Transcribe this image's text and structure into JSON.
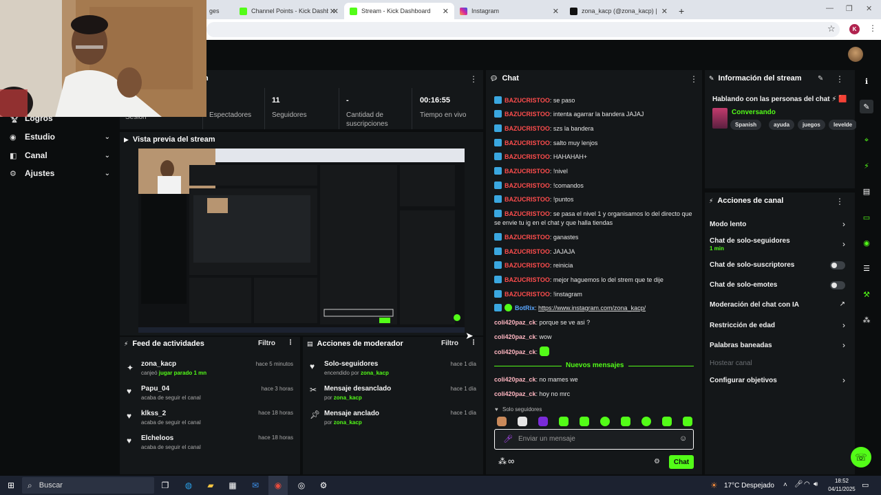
{
  "browser": {
    "tabs": [
      {
        "label": "ges",
        "close": "✕"
      },
      {
        "label": "Channel Points - Kick Dashboar",
        "close": "✕"
      },
      {
        "label": "Stream - Kick Dashboard",
        "close": "✕"
      },
      {
        "label": "Instagram",
        "close": "✕"
      },
      {
        "label": "zona_kacp (@zona_kacp) | TikT",
        "close": "✕"
      }
    ],
    "new_tab": "+",
    "profile_initial": "K"
  },
  "sidebar": {
    "items": [
      {
        "label": "Logros"
      },
      {
        "label": "Estudio"
      },
      {
        "label": "Canal"
      },
      {
        "label": "Ajustes"
      }
    ]
  },
  "stats": {
    "header_fragment": "n",
    "items": [
      {
        "value": "",
        "label": "Sesión"
      },
      {
        "value": "",
        "label": "Espectadores"
      },
      {
        "value": "11",
        "label": "Seguidores"
      },
      {
        "value": "-",
        "label": "Cantidad de suscripciones"
      },
      {
        "value": "00:16:55",
        "label": "Tiempo en vivo"
      }
    ]
  },
  "preview": {
    "title": "Vista previa del stream"
  },
  "feed": {
    "title": "Feed de actividades",
    "filter": "Filtro",
    "entries": [
      {
        "name": "zona_kacp",
        "pre": "canjeó ",
        "highlight": "jugar parado 1 mn",
        "post": "",
        "time": "hace 5 minutos"
      },
      {
        "name": "Papu_04",
        "pre": "acaba de seguir el canal",
        "highlight": "",
        "post": "",
        "time": "hace 3 horas"
      },
      {
        "name": "klkss_2",
        "pre": "acaba de seguir el canal",
        "highlight": "",
        "post": "",
        "time": "hace 18 horas"
      },
      {
        "name": "Elcheloos",
        "pre": "acaba de seguir el canal",
        "highlight": "",
        "post": "",
        "time": "hace 18 horas"
      }
    ]
  },
  "moderator": {
    "title": "Acciones de moderador",
    "filter": "Filtro",
    "entries": [
      {
        "title": "Solo-seguidores",
        "pre": "encendido por ",
        "highlight": "zona_kacp",
        "time": "hace 1 día"
      },
      {
        "title": "Mensaje desanclado",
        "pre": "por ",
        "highlight": "zona_kacp",
        "time": "hace 1 día"
      },
      {
        "title": "Mensaje anclado",
        "pre": "por ",
        "highlight": "zona_kacp",
        "time": "hace 1 día"
      }
    ]
  },
  "chat": {
    "title": "Chat",
    "messages": [
      {
        "user": "BAZUCRISTOO",
        "text": ": se paso"
      },
      {
        "user": "BAZUCRISTOO",
        "text": ": intenta agarrar la bandera JAJAJ"
      },
      {
        "user": "BAZUCRISTOO",
        "text": ": szs la bandera"
      },
      {
        "user": "BAZUCRISTOO",
        "text": ": salto muy lenjos"
      },
      {
        "user": "BAZUCRISTOO",
        "text": ": HAHAHAH+"
      },
      {
        "user": "BAZUCRISTOO",
        "text": ": !nivel"
      },
      {
        "user": "BAZUCRISTOO",
        "text": ": !comandos"
      },
      {
        "user": "BAZUCRISTOO",
        "text": ": !puntos"
      },
      {
        "user": "BAZUCRISTOO",
        "text": ": se pasa el nivel 1 y organisamos lo del directo que se envie tu ig en el chat y que halla tiendas"
      },
      {
        "user": "BAZUCRISTOO",
        "text": ": ganastes"
      },
      {
        "user": "BAZUCRISTOO",
        "text": ": JAJAJA"
      },
      {
        "user": "BAZUCRISTOO",
        "text": ": reinicia"
      },
      {
        "user": "BAZUCRISTOO",
        "text": ": mejor haguemos lo del strem que te dije"
      },
      {
        "user": "BAZUCRISTOO",
        "text": ": !instagram"
      }
    ],
    "bot": {
      "user": "BotRix",
      "text": "https://www.instagram.com/zona_kacp/"
    },
    "coli": [
      {
        "user": "coli420paz_ck",
        "text": ": porque se ve asi ?"
      },
      {
        "user": "coli420paz_ck",
        "text": ": wow"
      },
      {
        "user": "coli420paz_ck",
        "text": ":"
      }
    ],
    "new_messages": "Nuevos mensajes",
    "coli_after": [
      {
        "user": "coli420paz_ck",
        "text": ": no mames we"
      },
      {
        "user": "coli420paz_ck",
        "text": ": hoy no mrc"
      }
    ],
    "mode_label": "Solo seguidores",
    "input_placeholder": "Enviar un mensaje",
    "points": "∞",
    "send_label": "Chat"
  },
  "stream_info": {
    "title": "Información del stream",
    "stream_title": "Hablando con las personas del chat ⚡ 🟥",
    "category": "Conversando",
    "tags": [
      "Spanish",
      "ayuda",
      "juegos",
      "levelde"
    ]
  },
  "channel_actions": {
    "title": "Acciones de canal",
    "items": [
      {
        "label": "Modo lento",
        "sub": "",
        "control": "chevron"
      },
      {
        "label": "Chat de solo-seguidores",
        "sub": "1 min",
        "control": "chevron"
      },
      {
        "label": "Chat de solo-suscriptores",
        "sub": "",
        "control": "toggle"
      },
      {
        "label": "Chat de solo-emotes",
        "sub": "",
        "control": "toggle"
      },
      {
        "label": "Moderación del chat con IA",
        "sub": "",
        "control": "external"
      },
      {
        "label": "Restricción de edad",
        "sub": "",
        "control": "chevron"
      },
      {
        "label": "Palabras baneadas",
        "sub": "",
        "control": "chevron"
      },
      {
        "label": "Hostear canal",
        "sub": "",
        "control": "disabled"
      },
      {
        "label": "Configurar objetivos",
        "sub": "",
        "control": "chevron"
      }
    ]
  },
  "taskbar": {
    "search": "Buscar",
    "weather": "17°C Despejado",
    "time": "18:52",
    "date": "04/11/2025"
  },
  "colors": {
    "accent": "#53fc18",
    "username_red": "#ff4d4d",
    "username_pink": "#ffb6c1",
    "bot_blue": "#5aa7ff",
    "panel": "#141719",
    "background": "#0b0d0e"
  }
}
